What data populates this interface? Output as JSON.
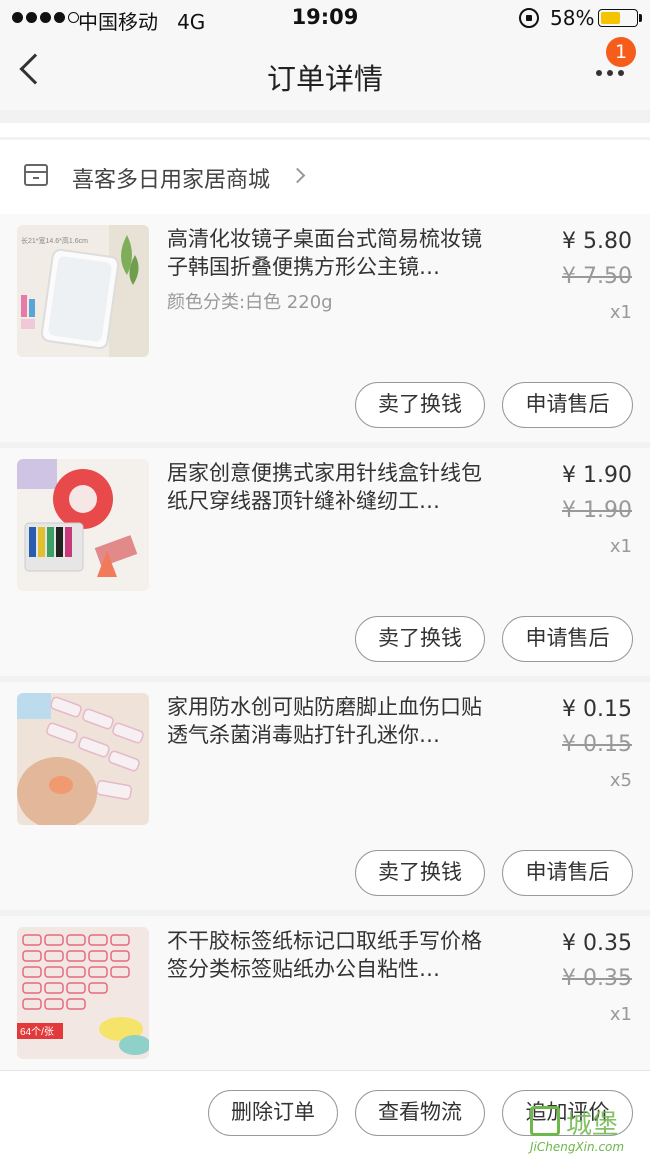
{
  "status_bar": {
    "carrier": "中国移动",
    "network": "4G",
    "time": "19:09",
    "battery": "58%",
    "battery_level": 0.58
  },
  "nav": {
    "title": "订单详情",
    "badge": "1",
    "back_icon": "chevron-left-icon",
    "more_icon": "more-dots-icon"
  },
  "shop": {
    "name": "喜客多日用家居商城",
    "icon": "store-icon"
  },
  "items": [
    {
      "title": "高清化妆镜子桌面台式简易梳妆镜子韩国折叠便携方形公主镜…",
      "spec": "颜色分类:白色 220g",
      "price": "¥ 5.80",
      "original_price": "¥ 7.50",
      "qty": "x1",
      "thumb_text": "长21*宽14.6*高1.6cm",
      "btn_sell": "卖了换钱",
      "btn_after": "申请售后"
    },
    {
      "title": "居家创意便携式家用针线盒针线包纸尺穿线器顶针缝补缝纫工…",
      "spec": "",
      "price": "¥ 1.90",
      "original_price": "¥ 1.90",
      "qty": "x1",
      "thumb_text": "",
      "btn_sell": "卖了换钱",
      "btn_after": "申请售后"
    },
    {
      "title": "家用防水创可贴防磨脚止血伤口贴透气杀菌消毒贴打针孔迷你…",
      "spec": "",
      "price": "¥ 0.15",
      "original_price": "¥ 0.15",
      "qty": "x5",
      "thumb_text": "",
      "btn_sell": "卖了换钱",
      "btn_after": "申请售后"
    },
    {
      "title": "不干胶标签纸标记口取纸手写价格签分类标签贴纸办公自粘性…",
      "spec": "",
      "price": "¥ 0.35",
      "original_price": "¥ 0.35",
      "qty": "x1",
      "thumb_text": "64个/张"
    }
  ],
  "bottom": {
    "delete": "删除订单",
    "logistics": "查看物流",
    "review": "追加评价"
  },
  "watermark": {
    "text": "城堡",
    "sub": "JiChengXin.com"
  }
}
